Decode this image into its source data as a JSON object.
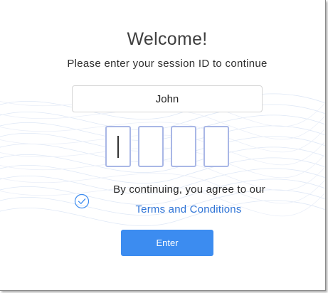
{
  "welcome": {
    "title": "Welcome!",
    "subtitle": "Please enter your session ID to continue"
  },
  "name_field": {
    "value": "John"
  },
  "session_code": {
    "digits": [
      "",
      "",
      "",
      ""
    ]
  },
  "consent": {
    "checked": true,
    "text": "By continuing, you agree to our",
    "link": "Terms and Conditions"
  },
  "actions": {
    "enter_label": "Enter"
  },
  "colors": {
    "accent": "#3c8cf0",
    "link": "#2f74d6",
    "code_border": "#a9b7e6"
  },
  "icons": {
    "consent_check": "check-circle-icon"
  }
}
